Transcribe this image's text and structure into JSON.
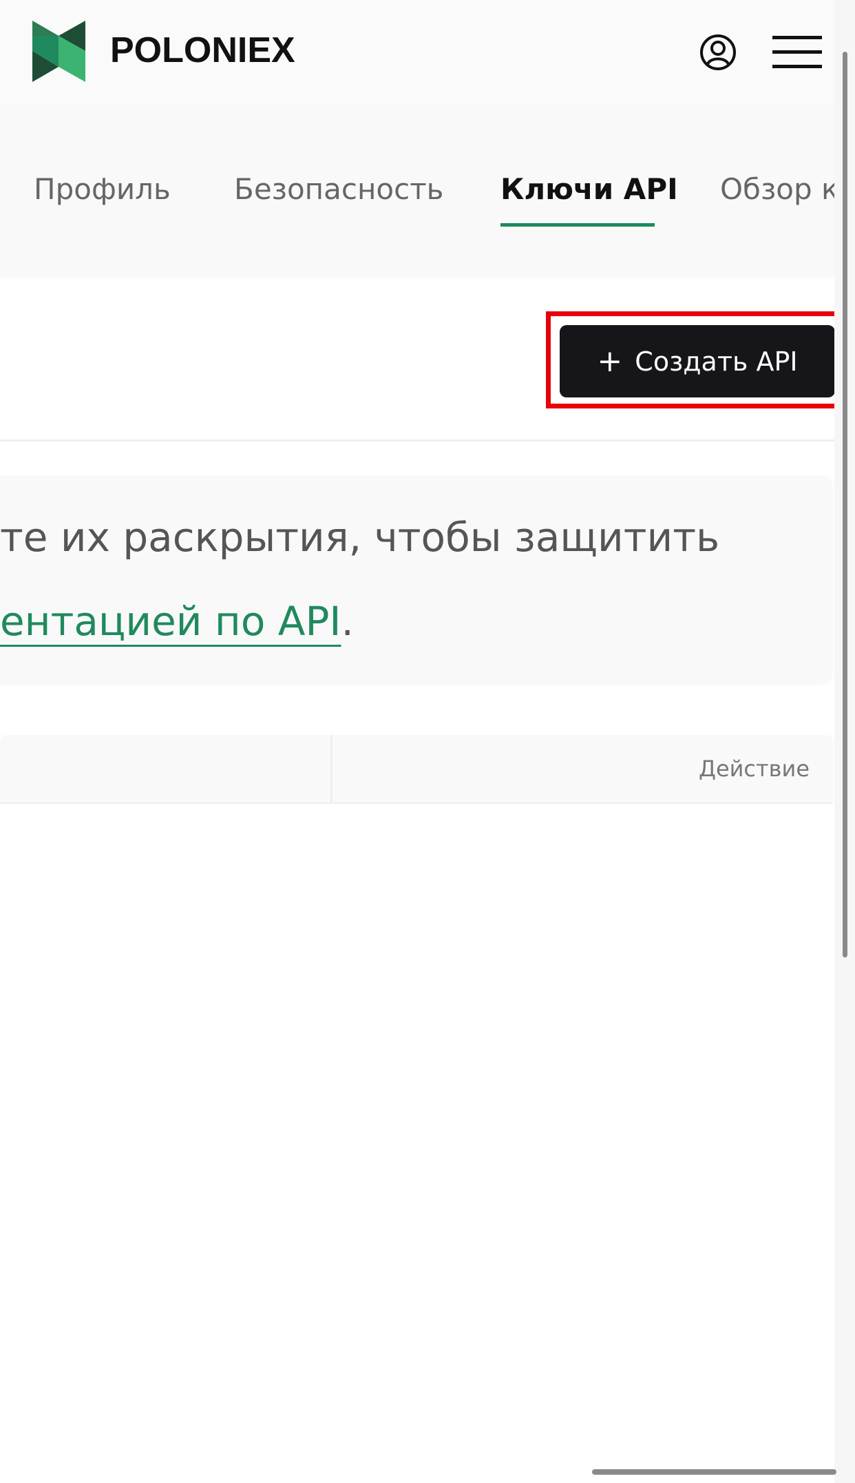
{
  "header": {
    "brand": "POLONIEX"
  },
  "tabs": [
    {
      "label": "Профиль",
      "active": false
    },
    {
      "label": "Безопасность",
      "active": false
    },
    {
      "label": "Ключи API",
      "active": true
    },
    {
      "label": "Обзор курсов",
      "active": false
    }
  ],
  "actions": {
    "create_api_label": "Создать API"
  },
  "notice": {
    "line1": "те их раскрытия, чтобы защитить",
    "link_text": "ентацией по API",
    "line2_suffix": "."
  },
  "table": {
    "columns": [
      "",
      "Действие"
    ]
  },
  "colors": {
    "accent": "#1f8a5d",
    "button_bg": "#16161a",
    "highlight": "#e8000a"
  },
  "icons": {
    "logo": "poloniex-logo-icon",
    "user": "user-circle-icon",
    "menu": "hamburger-menu-icon",
    "plus": "plus-icon"
  }
}
